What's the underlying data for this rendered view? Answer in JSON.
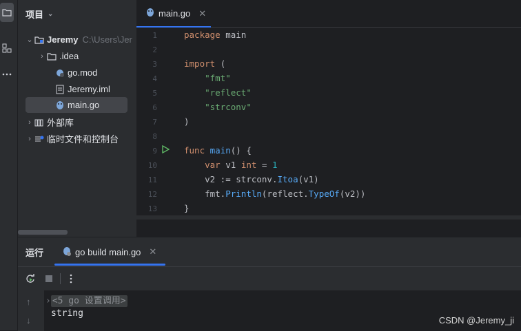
{
  "project": {
    "header": "项目",
    "root_name": "Jeremy",
    "root_path": "C:\\Users\\Jer",
    "items": [
      {
        "label": ".idea"
      },
      {
        "label": "go.mod"
      },
      {
        "label": "Jeremy.iml"
      },
      {
        "label": "main.go"
      },
      {
        "label": "外部库"
      },
      {
        "label": "临时文件和控制台"
      }
    ]
  },
  "editor": {
    "tab_label": "main.go",
    "line_numbers": [
      "1",
      "2",
      "3",
      "4",
      "5",
      "6",
      "7",
      "8",
      "9",
      "10",
      "11",
      "12",
      "13"
    ],
    "code": {
      "l1_kw": "package",
      "l1_name": "main",
      "l3_kw": "import",
      "l3_paren": "(",
      "l4": "\"fmt\"",
      "l5": "\"reflect\"",
      "l6": "\"strconv\"",
      "l7": ")",
      "l9_kw": "func",
      "l9_fn": "main",
      "l9_rest": "() {",
      "l10_kw": "var",
      "l10_var": "v1",
      "l10_type": "int",
      "l10_eq": "=",
      "l10_num": "1",
      "l11_var": "v2 :=",
      "l11_pkg": "strconv.",
      "l11_fn": "Itoa",
      "l11_args": "(v1)",
      "l12_pkg": "fmt.",
      "l12_fn": "Println",
      "l12_open": "(",
      "l12_pkg2": "reflect.",
      "l12_fn2": "TypeOf",
      "l12_args": "(v2))",
      "l13": "}"
    }
  },
  "run_panel": {
    "title": "运行",
    "tab_label": "go build main.go",
    "console_folded": "<5 go 设置调用>",
    "console_output": "string"
  },
  "watermark": "CSDN @Jeremy_ji",
  "colors": {
    "accent": "#3574f0",
    "keyword": "#cf8e6d",
    "string": "#6aab73",
    "number": "#2aacb8",
    "function": "#56a8f5"
  }
}
